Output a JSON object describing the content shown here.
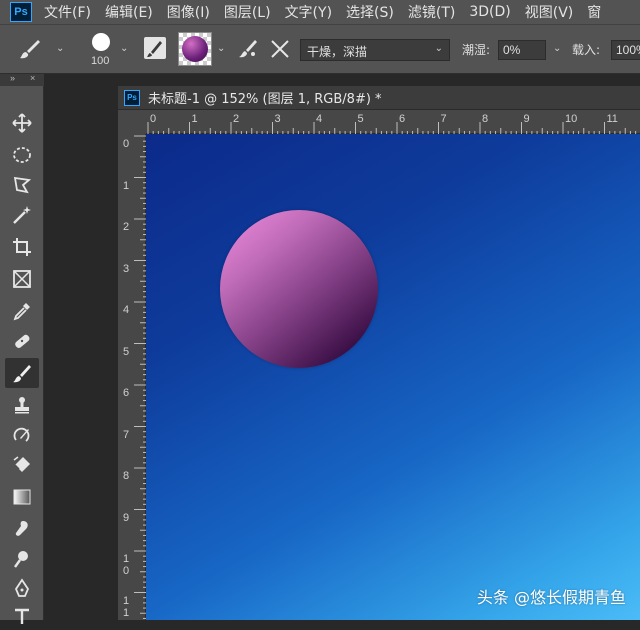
{
  "app": {
    "logo": "Ps"
  },
  "menu": [
    "文件(F)",
    "编辑(E)",
    "图像(I)",
    "图层(L)",
    "文字(Y)",
    "选择(S)",
    "滤镜(T)",
    "3D(D)",
    "视图(V)",
    "窗"
  ],
  "options": {
    "brush_size": "100",
    "mode_value": "干燥，深描",
    "wet_label": "潮湿:",
    "wet_value": "0%",
    "load_label": "载入:",
    "load_value": "100%"
  },
  "toolbar_icons": [
    "move-icon",
    "marquee-icon",
    "lasso-icon",
    "magic-wand-icon",
    "crop-icon",
    "frame-icon",
    "eyedropper-icon",
    "healing-brush-icon",
    "brush-icon",
    "stamp-icon",
    "history-brush-icon",
    "eraser-icon",
    "gradient-icon",
    "blur-icon",
    "dodge-icon",
    "pen-icon",
    "type-icon"
  ],
  "document": {
    "icon": "Ps",
    "title": "未标题-1 @ 152% (图层 1, RGB/8#) *",
    "h_ruler": [
      "0",
      "1",
      "2",
      "3",
      "4",
      "5",
      "6",
      "7",
      "8",
      "9",
      "10",
      "11"
    ],
    "v_ruler": [
      "0",
      "1",
      "2",
      "3",
      "4",
      "5",
      "6",
      "7",
      "8",
      "9",
      "10",
      "11"
    ]
  },
  "watermark": "头条 @悠长假期青鱼",
  "colors": {
    "panel": "#535353",
    "canvas_top": "#0c2a8a",
    "canvas_bottom": "#4bbcf7",
    "sphere_light": "#f28ce2",
    "sphere_dark": "#2a0734"
  }
}
